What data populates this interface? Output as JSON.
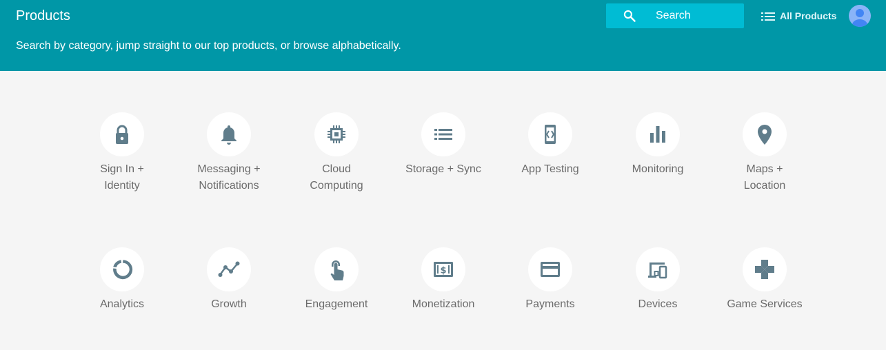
{
  "header": {
    "title": "Products",
    "subtitle": "Search by category, jump straight to our top products, or browse alphabetically.",
    "search_label": "Search",
    "all_products_label": "All Products",
    "background_color": "#0097a7",
    "search_color": "#00bcd4"
  },
  "icon_color": "#607d8b",
  "categories": [
    {
      "label": "Sign In +\nIdentity",
      "icon": "lock-icon"
    },
    {
      "label": "Messaging +\nNotifications",
      "icon": "bell-icon"
    },
    {
      "label": "Cloud\nComputing",
      "icon": "chip-icon"
    },
    {
      "label": "Storage + Sync",
      "icon": "list-icon"
    },
    {
      "label": "App Testing",
      "icon": "code-phone-icon"
    },
    {
      "label": "Monitoring",
      "icon": "bar-chart-icon"
    },
    {
      "label": "Maps +\nLocation",
      "icon": "location-pin-icon"
    },
    {
      "label": "Analytics",
      "icon": "donut-icon"
    },
    {
      "label": "Growth",
      "icon": "trend-icon"
    },
    {
      "label": "Engagement",
      "icon": "touch-icon"
    },
    {
      "label": "Monetization",
      "icon": "dollar-icon"
    },
    {
      "label": "Payments",
      "icon": "credit-card-icon"
    },
    {
      "label": "Devices",
      "icon": "devices-icon"
    },
    {
      "label": "Game Services",
      "icon": "gamepad-icon"
    }
  ]
}
